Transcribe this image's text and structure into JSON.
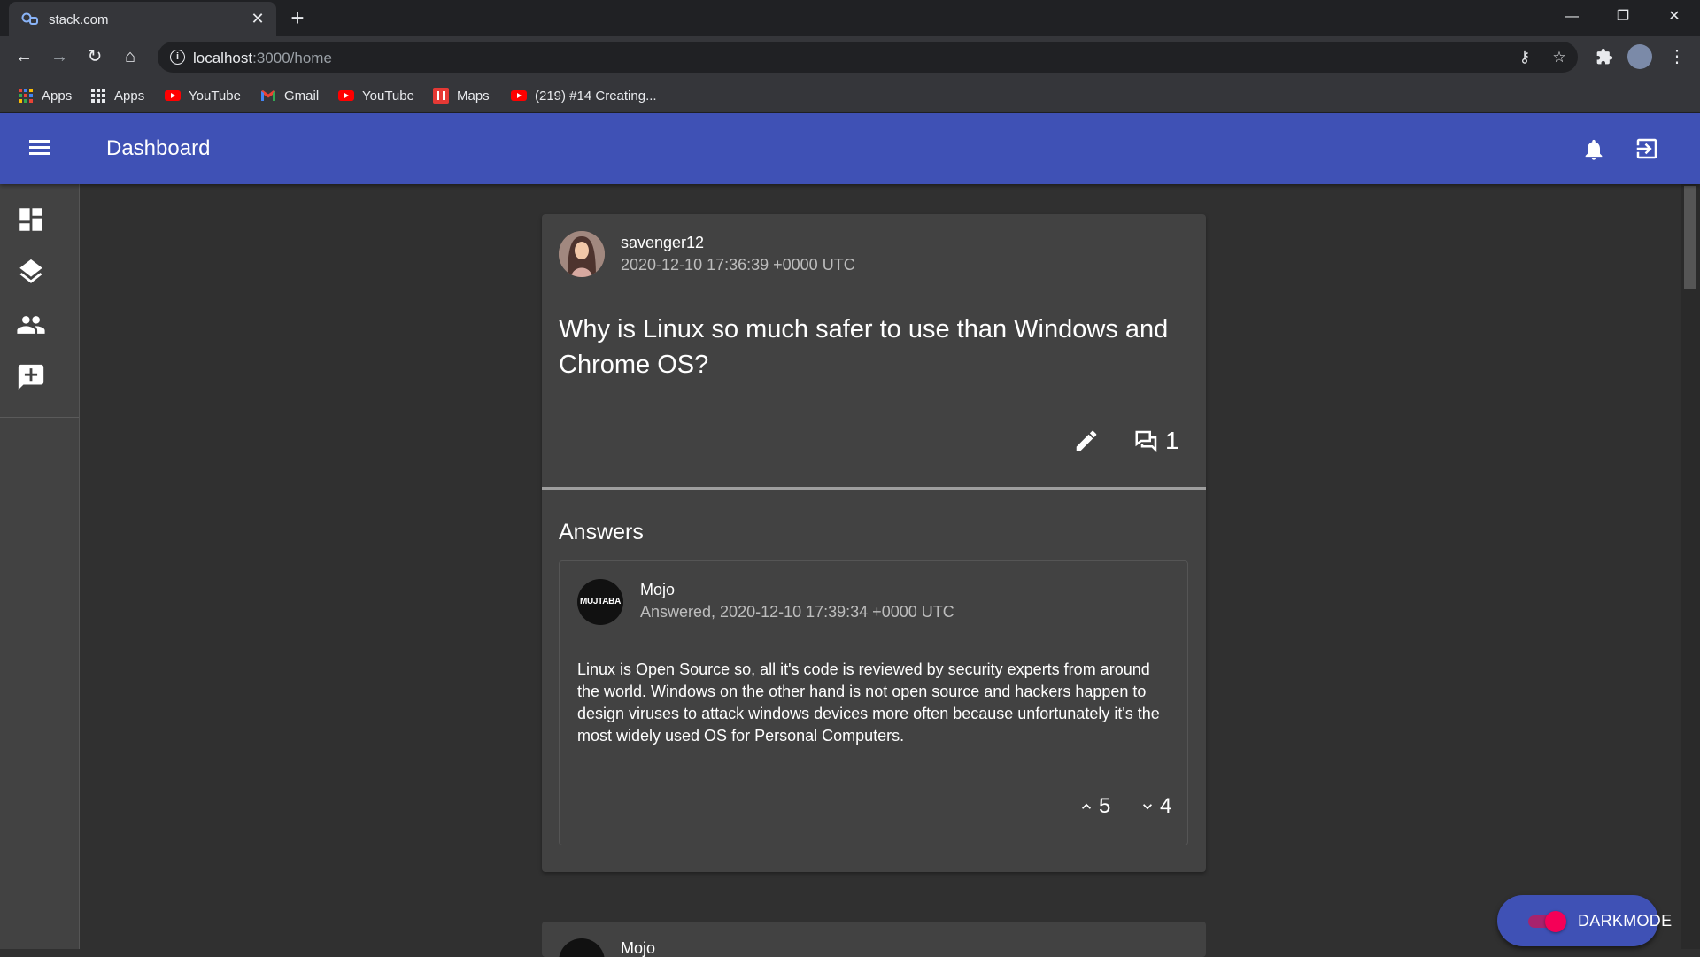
{
  "browser": {
    "tab_title": "stack.com",
    "url_host": "localhost",
    "url_rest": ":3000/home",
    "bookmarks": [
      {
        "label": "Apps",
        "icon": "apps-grid-icon"
      },
      {
        "label": "Apps",
        "icon": "apps-grid-icon"
      },
      {
        "label": "YouTube",
        "icon": "youtube-icon"
      },
      {
        "label": "Gmail",
        "icon": "gmail-icon"
      },
      {
        "label": "YouTube",
        "icon": "youtube-icon"
      },
      {
        "label": "Maps",
        "icon": "maps-icon"
      },
      {
        "label": "(219) #14 Creating...",
        "icon": "youtube-icon"
      }
    ]
  },
  "appbar": {
    "title": "Dashboard",
    "color": "#3f51b5"
  },
  "sidebar": {
    "items": [
      {
        "icon": "dashboard-icon"
      },
      {
        "icon": "layers-icon"
      },
      {
        "icon": "people-icon"
      },
      {
        "icon": "add-comment-icon"
      }
    ]
  },
  "question": {
    "username": "savenger12",
    "timestamp": "2020-12-10 17:36:39 +0000 UTC",
    "title": "Why is Linux so much safer to use than Windows and Chrome OS?",
    "comment_count": "1"
  },
  "answers": {
    "heading": "Answers",
    "items": [
      {
        "avatar_text": "MUJTABA",
        "username": "Mojo",
        "answered": "Answered, 2020-12-10 17:39:34 +0000 UTC",
        "body": "Linux is Open Source so, all it's code is reviewed by security experts from around the world. Windows on the other hand is not open source and hackers happen to design viruses to attack windows devices more often because unfortunately it's the most widely used OS for Personal Computers.",
        "upvotes": "5",
        "downvotes": "4"
      }
    ]
  },
  "next_post": {
    "username": "Mojo"
  },
  "darkmode": {
    "label": "DARKMODE",
    "enabled": true
  }
}
